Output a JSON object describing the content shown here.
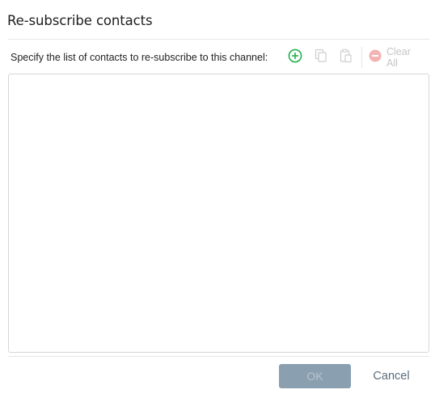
{
  "dialog": {
    "title": "Re-subscribe contacts",
    "instruction": "Specify the list of contacts to re-subscribe to this channel:"
  },
  "toolbar": {
    "add_icon": "add-circle-icon",
    "copy_icon": "copy-icon",
    "paste_icon": "paste-icon",
    "clear_icon": "remove-circle-icon",
    "clear_label": "Clear All",
    "colors": {
      "add": "#22b14c",
      "disabled": "#c9c9c9",
      "clear_icon": "#f3b3b3"
    }
  },
  "contacts_list": {
    "items": []
  },
  "footer": {
    "ok_label": "OK",
    "cancel_label": "Cancel",
    "ok_color": "#8a9fb0"
  }
}
